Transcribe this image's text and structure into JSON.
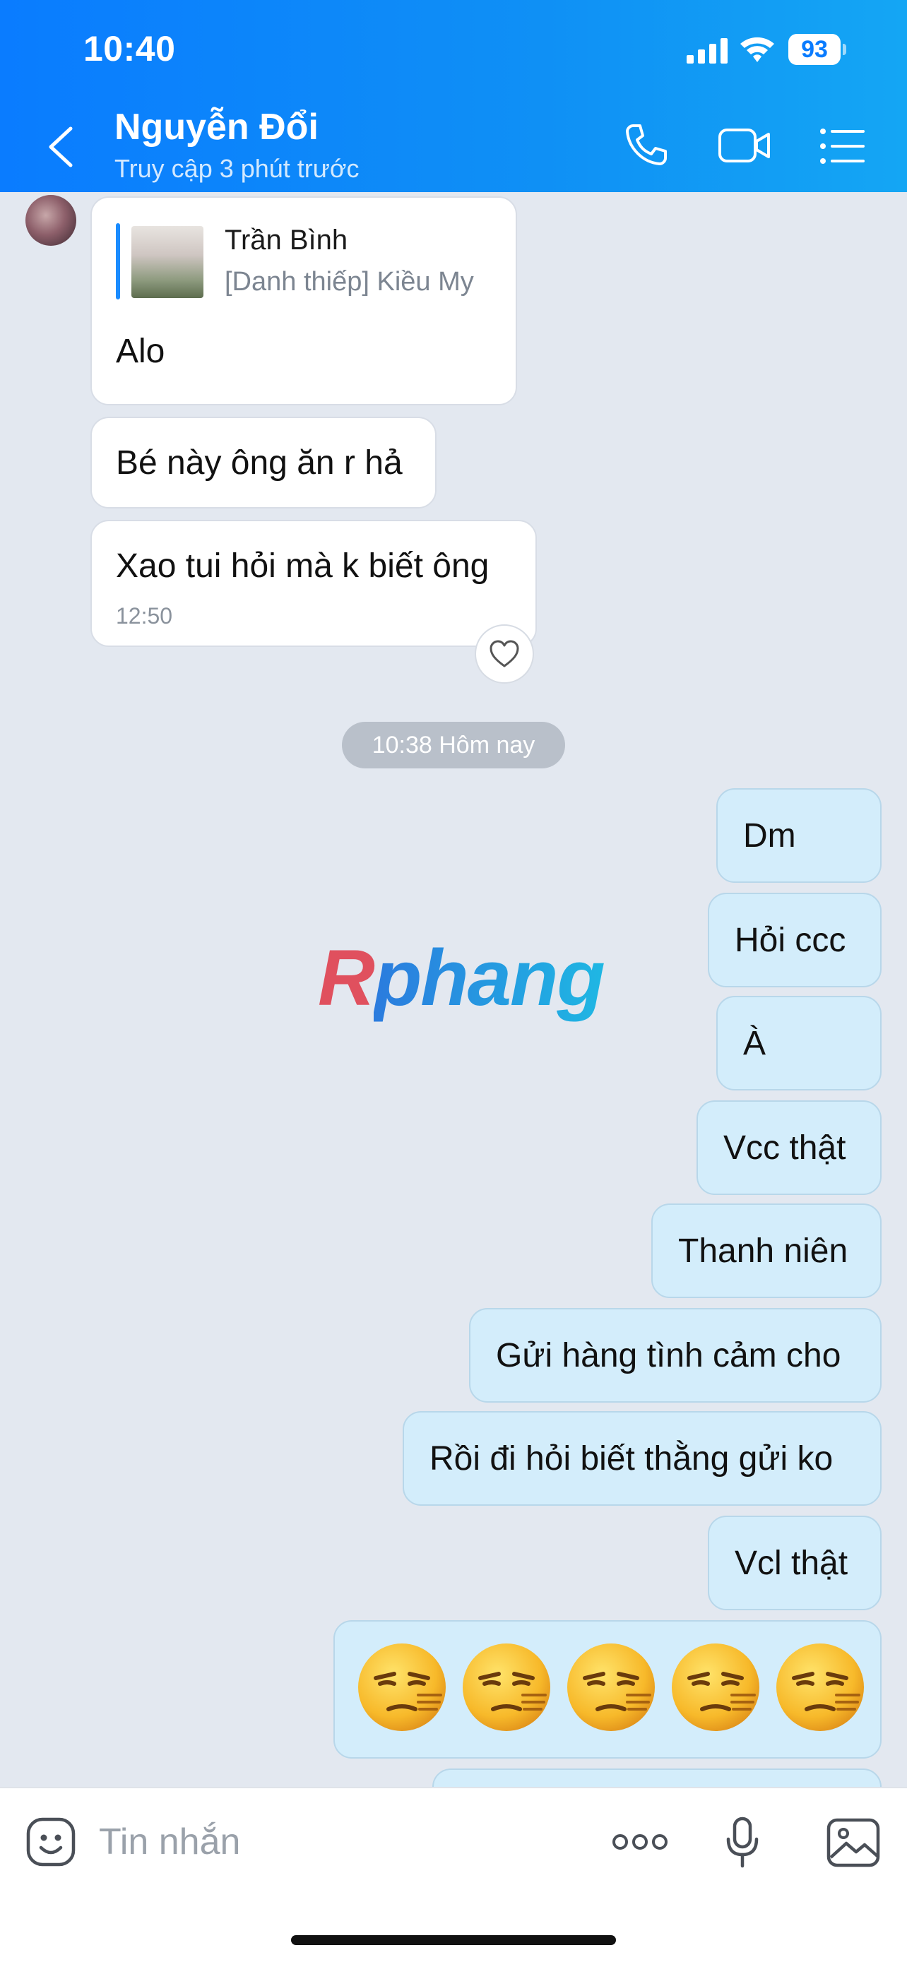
{
  "status_bar": {
    "time": "10:40",
    "battery": "93"
  },
  "header": {
    "contact_name": "Nguyễn Đổi",
    "contact_status": "Truy cập 3 phút trước"
  },
  "messages": {
    "quote": {
      "name": "Trần Bình",
      "sub": "[Danh thiếp] Kiều My",
      "text": "Alo"
    },
    "incoming": [
      {
        "text": "Bé này ông ăn r hả"
      },
      {
        "text": "Xao tui hỏi mà k biết ông",
        "time": "12:50"
      }
    ],
    "date_divider": "10:38 Hôm nay",
    "outgoing": [
      {
        "text": "Dm"
      },
      {
        "text": "Hỏi ccc"
      },
      {
        "text": "À"
      },
      {
        "text": "Vcc thật"
      },
      {
        "text": "Thanh niên"
      },
      {
        "text": "Gửi hàng tình cảm cho"
      },
      {
        "text": "Rồi đi hỏi biết thằng gửi ko"
      },
      {
        "text": "Vcl thật"
      }
    ],
    "emoji_reaction_count": 5
  },
  "watermark": {
    "first": "R",
    "rest": "phang"
  },
  "input": {
    "placeholder": "Tin nhắn"
  },
  "colors": {
    "header_blue": "#0a7cff",
    "chat_background": "#e3e8f0",
    "outgoing_bubble": "#d3edfb",
    "incoming_bubble": "#ffffff"
  },
  "icons": [
    "back-icon",
    "phone-icon",
    "video-call-icon",
    "list-menu-icon",
    "heart-icon",
    "sticker-icon",
    "more-icon",
    "microphone-icon",
    "image-icon"
  ]
}
